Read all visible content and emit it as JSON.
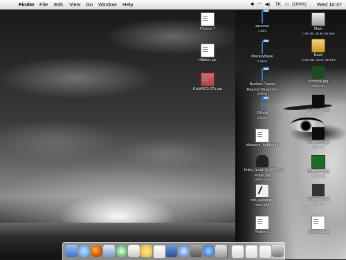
{
  "menubar": {
    "apple_glyph": "",
    "app_name": "Finder",
    "menus": [
      "File",
      "Edit",
      "View",
      "Go",
      "Window",
      "Help"
    ],
    "battery": "(100%)",
    "volume_level": "7K",
    "clock": "Wed 10:37"
  },
  "desktop_icons": {
    "picture7": {
      "label": "Picture 7"
    },
    "hidden_file": {
      "label": "Hidden.ssr"
    },
    "kismac_zip": {
      "label": "KisMAC0.07b.zip"
    },
    "azureus": {
      "label": "azureus",
      "sub": "1 item"
    },
    "mackeybase": {
      "label": "MackeyBase",
      "sub": "1 items"
    },
    "nuclear": {
      "label": "Nuclear Fusion",
      "label2": "Reactor Blueprints",
      "sub": "3 items"
    },
    "zunkay": {
      "label": "ZKtoid",
      "sub": "1 items"
    },
    "nhtscore": {
      "label": "nhtscore_bobbyr.rtf"
    },
    "knira": {
      "label": "knira_head_bl.1024_nr_",
      "label2": "esige.jpg",
      "sub": "1280 x 1024"
    },
    "jaguar": {
      "label": "osx-jaguar.jpg",
      "sub": "229 x 282"
    },
    "picture1": {
      "label": "Picture 1"
    },
    "main_hd": {
      "label": "Main",
      "sub": "1.58 GB, 45.66 GB free"
    },
    "backup_hd": {
      "label": "Back",
      "sub": "74.52 GB, 18.47 GB free"
    },
    "thumb1": {
      "label": "terminal.jpg",
      "sub": "800 x 30"
    },
    "thumb2": {
      "label": "terminal2.jpg",
      "sub": "580 x 14"
    },
    "thumb3": {
      "label": "terminal3.jpg",
      "sub": "800 x 20"
    },
    "thumb4": {
      "label": "terminal4.jpg",
      "sub": "480 x 960"
    },
    "thumb5": {
      "label": "terminal5.jpg",
      "sub": "480 x 25"
    },
    "kismac_doc": {
      "label": "KisMAC.log"
    }
  },
  "dock": {
    "items": [
      "finder-icon",
      "ichat-icon",
      "firefox-icon",
      "mail-icon",
      "itunes-icon",
      "terminal-icon",
      "iphoto-icon",
      "ical-icon",
      "network-icon",
      "safari-icon",
      "system-prefs-icon",
      "quicktime-icon",
      "preview-icon",
      "itunes2-icon",
      "document-icon",
      "document2-icon",
      "trash-icon"
    ]
  }
}
